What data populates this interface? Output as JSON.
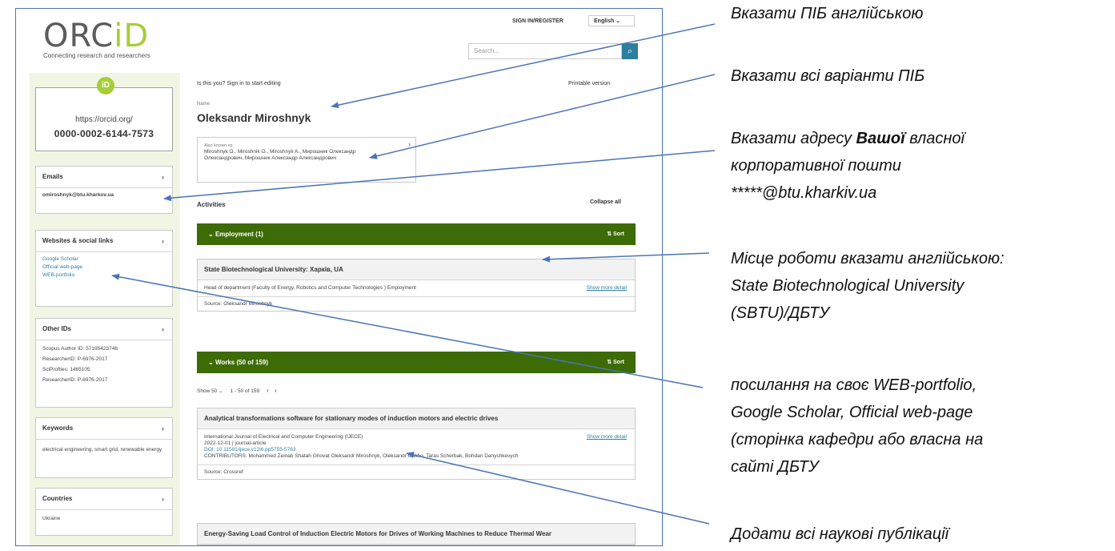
{
  "orcid": {
    "logo_main": "ORC",
    "logo_id": "iD",
    "tagline": "Connecting research and researchers",
    "signin": "SIGN IN/REGISTER",
    "language": "English",
    "search_placeholder": "Search...",
    "id_badge": "iD",
    "profile_url": "https://orcid.org/",
    "orcid_id": "0000-0002-6144-7573",
    "viewing": "Is this you? Sign in to start editing",
    "printable": "Printable version",
    "name_label": "Name",
    "name": "Oleksandr Miroshnyk",
    "also_known_label": "Also known as",
    "also_known": "Miroshnyk O., Miroshnik O., Miroshnyk A., Мирошник Олександр Олександрович, Мирошник Александр Александрович",
    "activities": "Activities",
    "collapse_all": "Collapse all",
    "emails": {
      "title": "Emails",
      "value": "omiroshnyk@btu.kharkov.ua"
    },
    "websites": {
      "title": "Websites & social links",
      "items": [
        "Google Scholar",
        "Official web-page",
        "WEB-portfolio"
      ]
    },
    "other_ids": {
      "title": "Other IDs",
      "items": [
        "Scopus Author ID: 57195423746",
        "ResearcherID: P-6976-2017",
        "SciProfiles: 1465105",
        "ResearcherID: P-6976-2017"
      ]
    },
    "keywords": {
      "title": "Keywords",
      "value": "electrical engineering, smart grid, renewable energy"
    },
    "countries": {
      "title": "Countries",
      "value": "Ukraine"
    },
    "employment": {
      "band": "Employment (1)",
      "sort": "Sort",
      "title": "State Biotechnological University: Харків, UA",
      "detail": "Head of department (Faculty of Energy, Robotics and Computer Technologies ) Employment",
      "more": "Show more detail",
      "source": "Source: Oleksandr Miroshnyk"
    },
    "works": {
      "band": "Works (50 of 159)",
      "sort": "Sort",
      "per_page": "Show 50",
      "range": "1 - 50 of 159",
      "prev": "‹",
      "next": "›",
      "item1_title": "Analytical transformations software for stationary modes of induction motors and electric drives",
      "item1_journal": "International Journal of Electrical and Computer Engineering (IJECE)",
      "item1_date": "2022-12-01 | journal-article",
      "item1_doi": "DOI: 10.11591/ijece.v12i6.pp5755-5763",
      "item1_contrib": "CONTRIBUTORS: Mohammed Zeinab Shatah Ghovat Oleksandr Miroshnyk, Oleksandr Gakho, Taras Scherbak, Bohdan Danyshkevych",
      "item1_more": "Show more detail",
      "item1_source": "Source: Crossref",
      "item2_title": "Energy-Saving Load Control of Induction Electric Motors for Drives of Working Machines to Reduce Thermal Wear"
    }
  },
  "notes": [
    "Вказати ПІБ англійською",
    "Вказати всі варіанти ПІБ",
    "Вказати адресу",
    "Вашої",
    "власної",
    "корпоративної пошти",
    "*****@btu.kharkiv.ua",
    "Місце роботи вказати англійською:",
    "State Biotechnological University",
    "(SBTU)/ДБТУ",
    "посилання на своє WEB-portfolio,",
    "Google Scholar, Official web-page",
    "(сторінка кафедри або власна на",
    "сайті ДБТУ",
    "Додати всі наукові публікації"
  ],
  "colors": {
    "arrow": "#4a74b5",
    "orcid_green": "#a6ce39",
    "band_green": "#3d6b06"
  }
}
